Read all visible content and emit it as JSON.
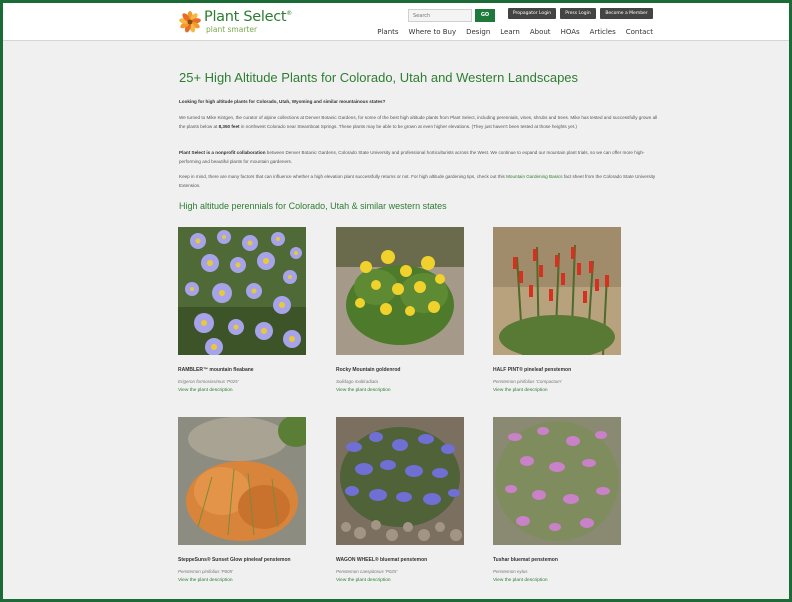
{
  "header": {
    "brand": "Plant Select",
    "brand_mark": "®",
    "tagline": "plant smarter",
    "search": {
      "placeholder": "Search"
    },
    "go_label": "GO",
    "top_buttons": [
      "Propagator Login",
      "Press Login",
      "Become a Member"
    ],
    "nav": [
      "Plants",
      "Where to Buy",
      "Design",
      "Learn",
      "About",
      "HOAs",
      "Articles",
      "Contact"
    ]
  },
  "main": {
    "title": "25+ High Altitude Plants for Colorado, Utah and Western Landscapes",
    "intro_question": "Looking for high altitude plants for Colorado, Utah, Wyoming and similar mountainous states?",
    "p1_a": "We turned to Mike Kintgen, the curator of alpine collections at Denver Botanic Gardens, for some of the best high altitude plants from Plant Select, including perennials, vines, shrubs and trees. Mike has tested and successfully grown all the plants below at ",
    "p1_bold": "8,350 feet",
    "p1_b": " in northwest Colorado near Steamboat Springs. These plants may be able to be grown at even higher elevations. (They just haven't been tested at those heights yet.)",
    "p2_bold": "Plant Select is a nonprofit collaboration",
    "p2_rest": " between Denver Botanic Gardens, Colorado State University and professional horticulturists across the West. We continue to expand our mountain plant trials, so we can offer more high-performing and beautiful plants for mountain gardeners.",
    "p3_a": "Keep in mind, there are many factors that can influence whether a high elevation plant successfully returns or not. For high altitude gardening tips, check out this ",
    "p3_link": "Mountain Gardening Basics",
    "p3_b": " fact sheet from the Colorado State University Extension.",
    "section_title": "High altitude perennials for Colorado, Utah & similar western states"
  },
  "plants": [
    {
      "name": "RAMBLER™ mountain fleabane",
      "scientific": "Erigeron formosissimus 'P025'",
      "link": "View the plant description",
      "photo": "lavender-daisy-photo"
    },
    {
      "name": "Rocky Mountain goldenrod",
      "scientific": "Solidago multiradiata",
      "link": "View the plant description",
      "photo": "yellow-flower-photo"
    },
    {
      "name": "HALF PINT® pineleaf penstemon",
      "scientific": "Penstemon pinifolius 'Compactum'",
      "link": "View the plant description",
      "photo": "red-penstemon-photo"
    },
    {
      "name": "SteppeSuns® Sunset Glow pineleaf penstemon",
      "scientific": "Penstemon pinifolius 'P005'",
      "link": "View the plant description",
      "photo": "orange-penstemon-photo"
    },
    {
      "name": "WAGON WHEEL® bluemat penstemon",
      "scientific": "Penstemon caespitosus 'P025'",
      "link": "View the plant description",
      "photo": "blue-penstemon-photo"
    },
    {
      "name": "Tushar bluemat penstemon",
      "scientific": "Penstemon eylus",
      "link": "View the plant description",
      "photo": "pink-penstemon-photo"
    }
  ],
  "colors": {
    "brand_green": "#2e7d32",
    "frame_green": "#1b6b36",
    "go_green": "#1d7a3b"
  }
}
